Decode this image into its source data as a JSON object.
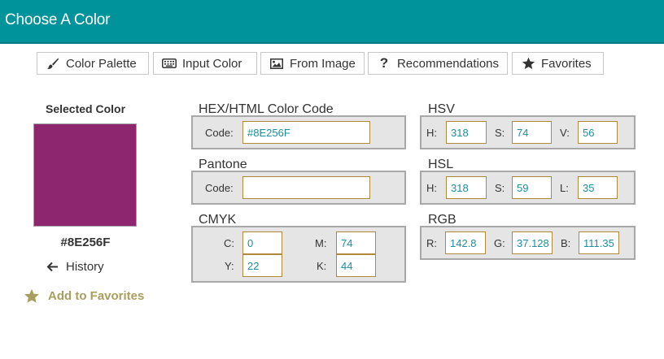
{
  "header": {
    "title": "Choose A Color"
  },
  "tabs": [
    {
      "label": "Color Palette",
      "icon": "brush-icon"
    },
    {
      "label": "Input Color",
      "icon": "keyboard-icon"
    },
    {
      "label": "From Image",
      "icon": "image-icon"
    },
    {
      "label": "Recommendations",
      "icon": "question-icon"
    },
    {
      "label": "Favorites",
      "icon": "star-icon"
    }
  ],
  "selected": {
    "label": "Selected Color",
    "hex": "#8E256F",
    "color": "#8E256F",
    "history_label": "History",
    "favorites_label": "Add to Favorites",
    "favorites_color": "#a89e5e"
  },
  "hex_section": {
    "title": "HEX/HTML Color Code",
    "code_label": "Code:",
    "code_value": "#8E256F"
  },
  "pantone": {
    "title": "Pantone",
    "code_label": "Code:",
    "code_value": ""
  },
  "cmyk": {
    "title": "CMYK",
    "c_label": "C:",
    "c": "0",
    "m_label": "M:",
    "m": "74",
    "y_label": "Y:",
    "y": "22",
    "k_label": "K:",
    "k": "44"
  },
  "hsv": {
    "title": "HSV",
    "h_label": "H:",
    "h": "318",
    "s_label": "S:",
    "s": "74",
    "v_label": "V:",
    "v": "56"
  },
  "hsl": {
    "title": "HSL",
    "h_label": "H:",
    "h": "318",
    "s_label": "S:",
    "s": "59",
    "l_label": "L:",
    "l": "35"
  },
  "rgb": {
    "title": "RGB",
    "r_label": "R:",
    "r": "142.8",
    "g_label": "G:",
    "g": "37.128",
    "b_label": "B:",
    "b": "111.35"
  },
  "colors": {
    "header": "#00939b",
    "field_text": "#1a8fa0",
    "field_border": "#b08a3a"
  }
}
